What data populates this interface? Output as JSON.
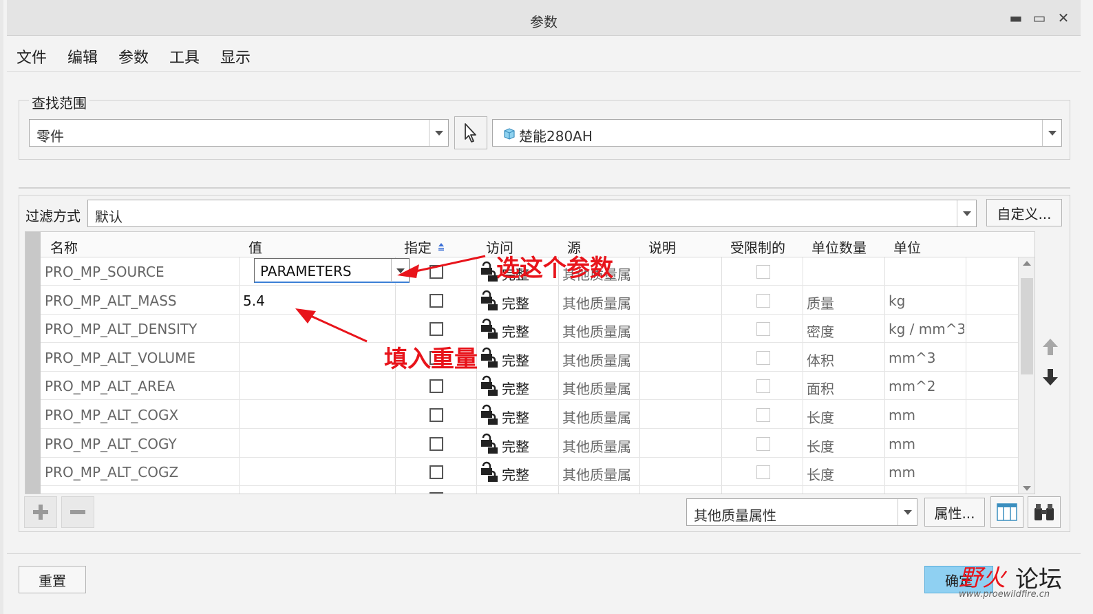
{
  "window": {
    "title": "参数"
  },
  "menu": [
    "文件",
    "编辑",
    "参数",
    "工具",
    "显示"
  ],
  "scope": {
    "label": "查找范围",
    "type_value": "零件",
    "model_value": "楚能280AH"
  },
  "filter": {
    "label": "过滤方式",
    "value": "默认",
    "customize_label": "自定义..."
  },
  "table": {
    "columns": [
      "名称",
      "值",
      "指定",
      "访问",
      "源",
      "说明",
      "受限制的",
      "单位数量",
      "单位"
    ],
    "rows": [
      {
        "name": "PRO_MP_SOURCE",
        "value": "PARAMETERS",
        "access": "完整",
        "source": "其他质量属",
        "desc": "",
        "quantity": "",
        "unit": ""
      },
      {
        "name": "PRO_MP_ALT_MASS",
        "value": "5.4",
        "access": "完整",
        "source": "其他质量属",
        "desc": "",
        "quantity": "质量",
        "unit": "kg"
      },
      {
        "name": "PRO_MP_ALT_DENSITY",
        "value": "",
        "access": "完整",
        "source": "其他质量属",
        "desc": "",
        "quantity": "密度",
        "unit": "kg / mm^3"
      },
      {
        "name": "PRO_MP_ALT_VOLUME",
        "value": "",
        "access": "完整",
        "source": "其他质量属",
        "desc": "",
        "quantity": "体积",
        "unit": "mm^3"
      },
      {
        "name": "PRO_MP_ALT_AREA",
        "value": "",
        "access": "完整",
        "source": "其他质量属",
        "desc": "",
        "quantity": "面积",
        "unit": "mm^2"
      },
      {
        "name": "PRO_MP_ALT_COGX",
        "value": "",
        "access": "完整",
        "source": "其他质量属",
        "desc": "",
        "quantity": "长度",
        "unit": "mm"
      },
      {
        "name": "PRO_MP_ALT_COGY",
        "value": "",
        "access": "完整",
        "source": "其他质量属",
        "desc": "",
        "quantity": "长度",
        "unit": "mm"
      },
      {
        "name": "PRO_MP_ALT_COGZ",
        "value": "",
        "access": "完整",
        "source": "其他质量属",
        "desc": "",
        "quantity": "长度",
        "unit": "mm"
      }
    ]
  },
  "bottom": {
    "category_value": "其他质量属性",
    "properties_label": "属性...",
    "reset_label": "重置",
    "ok_label": "确定"
  },
  "annotations": {
    "select_param": "选这个参数",
    "fill_weight": "填入重量"
  },
  "watermark": {
    "brand_a": "野火",
    "brand_b": "论坛",
    "url": "www.proewildfire.cn"
  },
  "colors": {
    "annotation_red": "#e8141b",
    "ok_button_blue": "#8fd0f2",
    "focus_blue": "#3b7fd6"
  }
}
